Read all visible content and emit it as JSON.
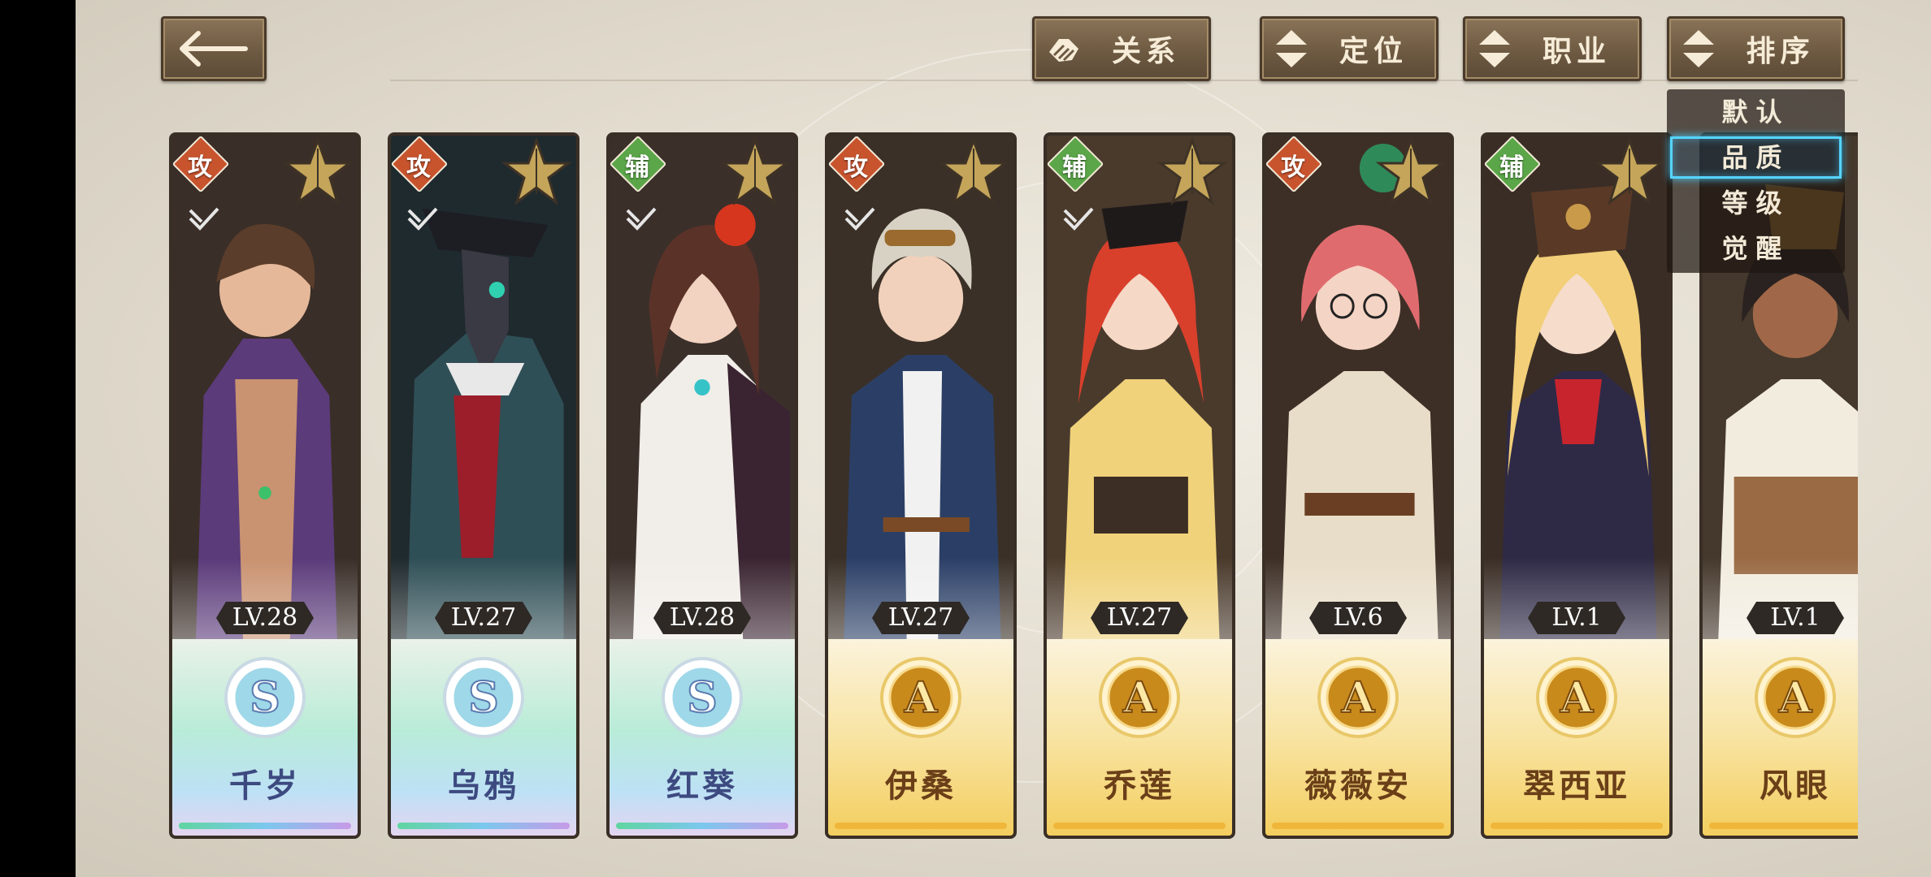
{
  "header": {
    "back_icon": "arrow-left-icon",
    "buttons": [
      {
        "label": "关系",
        "icon": "handshake-icon"
      },
      {
        "label": "定位",
        "icon": "sort-arrows-icon"
      },
      {
        "label": "职业",
        "icon": "sort-arrows-icon"
      },
      {
        "label": "排序",
        "icon": "sort-arrows-icon"
      }
    ]
  },
  "sort_menu": {
    "items": [
      "默认",
      "品质",
      "等级",
      "觉醒"
    ],
    "selected": "品质"
  },
  "cards": [
    {
      "name": "千岁",
      "level": "LV.28",
      "rank": "S",
      "role": "攻",
      "role_type": "attack"
    },
    {
      "name": "乌鸦",
      "level": "LV.27",
      "rank": "S",
      "role": "攻",
      "role_type": "attack"
    },
    {
      "name": "红葵",
      "level": "LV.28",
      "rank": "S",
      "role": "辅",
      "role_type": "support"
    },
    {
      "name": "伊桑",
      "level": "LV.27",
      "rank": "A",
      "role": "攻",
      "role_type": "attack"
    },
    {
      "name": "乔莲",
      "level": "LV.27",
      "rank": "A",
      "role": "辅",
      "role_type": "support"
    },
    {
      "name": "薇薇安",
      "level": "LV.6",
      "rank": "A",
      "role": "攻",
      "role_type": "attack"
    },
    {
      "name": "翠西亚",
      "level": "LV.1",
      "rank": "A",
      "role": "辅",
      "role_type": "support"
    },
    {
      "name": "风眼",
      "level": "LV.1",
      "rank": "A",
      "role": "",
      "role_type": "none"
    }
  ],
  "colors": {
    "button_bg": "#6e5a42",
    "attack_role": "#c8542e",
    "support_role": "#5aa648",
    "rank_s_name": "#3d4a80",
    "rank_a_name": "#6a3f18",
    "menu_highlight": "#56d4ff"
  }
}
